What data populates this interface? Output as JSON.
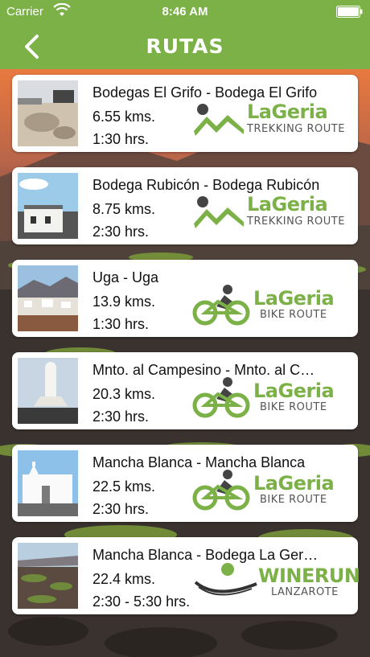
{
  "status": {
    "carrier": "Carrier",
    "time": "8:46 AM",
    "wifi_icon": "wifi-icon",
    "battery_icon": "battery-icon"
  },
  "nav": {
    "title": "RUTAS",
    "back_icon": "chevron-left-icon"
  },
  "colors": {
    "bar_green": "#7bb147",
    "brand_green": "#7bb147",
    "text": "#111111"
  },
  "routes": [
    {
      "title": "Bodegas El Grifo - Bodega El Grifo",
      "distance": "6.55 kms.",
      "time": "1:30 hrs.",
      "logo": {
        "type": "trekking",
        "brand": "LaGeria",
        "sub": "TREKKING ROUTE"
      }
    },
    {
      "title": "Bodega Rubicón - Bodega Rubicón",
      "distance": "8.75 kms.",
      "time": "2:30 hrs.",
      "logo": {
        "type": "trekking",
        "brand": "LaGeria",
        "sub": "TREKKING ROUTE"
      }
    },
    {
      "title": "Uga - Uga",
      "distance": "13.9 kms.",
      "time": "1:30 hrs.",
      "logo": {
        "type": "bike",
        "brand": "LaGeria",
        "sub": "BIKE ROUTE"
      }
    },
    {
      "title": "Mnto. al Campesino - Mnto. al C…",
      "distance": "20.3 kms.",
      "time": "2:30 hrs.",
      "logo": {
        "type": "bike",
        "brand": "LaGeria",
        "sub": "BIKE ROUTE"
      }
    },
    {
      "title": "Mancha Blanca - Mancha Blanca",
      "distance": "22.5 kms.",
      "time": "2:30 hrs.",
      "logo": {
        "type": "bike",
        "brand": "LaGeria",
        "sub": "BIKE ROUTE"
      }
    },
    {
      "title": "Mancha Blanca - Bodega La Ger…",
      "distance": "22.4 kms.",
      "time": "2:30 - 5:30 hrs.",
      "logo": {
        "type": "wine",
        "brand": "WINERUN",
        "sub": "LANZAROTE"
      }
    }
  ]
}
